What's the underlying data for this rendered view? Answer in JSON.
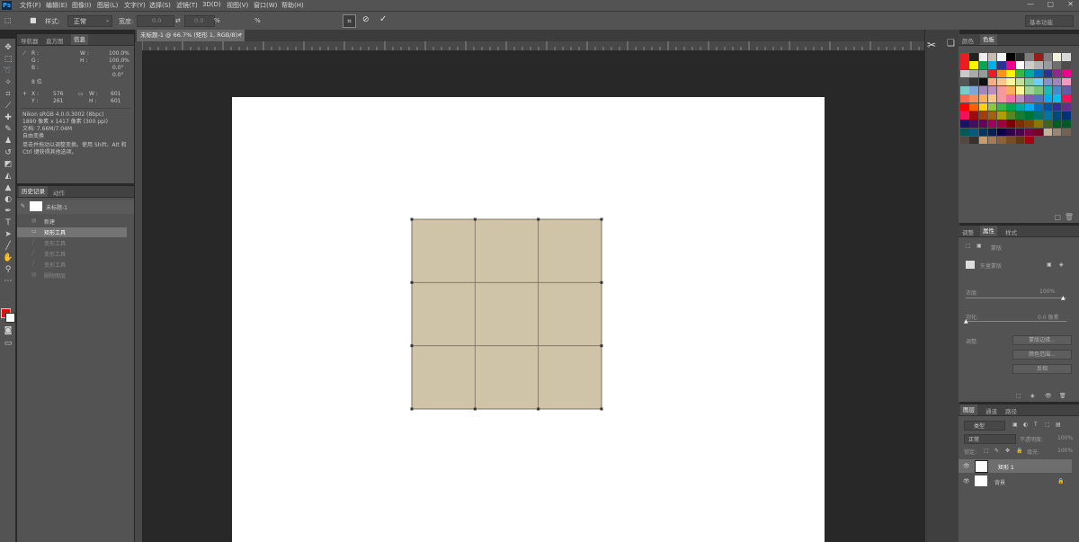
{
  "menu": {
    "logo": "Ps",
    "items": [
      "文件(F)",
      "编辑(E)",
      "图像(I)",
      "图层(L)",
      "文字(Y)",
      "选择(S)",
      "滤镜(T)",
      "3D(D)",
      "视图(V)",
      "窗口(W)",
      "帮助(H)"
    ]
  },
  "options": {
    "style_label": "样式:",
    "style_value": "正常",
    "width_label": "宽度:",
    "width_value": "0.0",
    "height_value": "0.0",
    "unit": "%",
    "search_placeholder": "基本功能"
  },
  "document": {
    "tab_title": "未标题-1 @ 66.7% (矩形 1, RGB/8) *"
  },
  "info_panel": {
    "tabs": [
      "导航器",
      "直方图",
      "信息"
    ],
    "rgb": [
      "R :",
      "G :",
      "B :"
    ],
    "bit": "8 位",
    "x_label": "X :",
    "x_value": "576",
    "y_label": "Y :",
    "y_value": "261",
    "w_label": "W :",
    "w_value": "601",
    "h_label": "H :",
    "h_value": "601",
    "pct_w": "100.0%",
    "pct_h": "100.0%",
    "angle1": "0.0°",
    "angle2": "0.0°",
    "doc_line1": "Nikon sRGB 4.0.0.3002 (8bpc)",
    "doc_line2": "1890 像素 x 1417 像素 (300 ppi)",
    "doc_line3": "文档: 7.66M/7.04M",
    "doc_line4": "自由变换",
    "hint": "单击并拖动以调整变换。使用 Shift、Alt 和 Ctrl 键获得其他选项。"
  },
  "history_panel": {
    "tabs": [
      "历史记录",
      "动作"
    ],
    "snapshot": "未标题-1",
    "items": [
      "新建",
      "矩形工具",
      "变形工具",
      "变形工具",
      "变形工具",
      "删除图层"
    ]
  },
  "swatches_panel": {
    "tabs": [
      "颜色",
      "色板"
    ],
    "colors": [
      "#ec1c24",
      "#222222",
      "#eeeeee",
      "#c8beb0",
      "#f4f4f4",
      "#000000",
      "#2b2b2b",
      "#7d7d7d",
      "#9b1b1b",
      "#7f7f7f",
      "#f2f2dc",
      "#d8d8d8",
      "#ed1c24",
      "#fff200",
      "#00a651",
      "#00aeef",
      "#2e3192",
      "#ec008c",
      "#ffffff",
      "#cdcdcd",
      "#b2b2b2",
      "#9a9a9a",
      "#6f6f6f",
      "#4d4d4d",
      "#c9c9c9",
      "#aaaaaa",
      "#9b9b9b",
      "#ed1c24",
      "#f7941d",
      "#fff200",
      "#39b54a",
      "#00a99d",
      "#0072bc",
      "#2e3192",
      "#92278f",
      "#ec008c",
      "#555555",
      "#333333",
      "#111111",
      "#f9ad81",
      "#fdc689",
      "#fff799",
      "#c4df9b",
      "#82ca9c",
      "#6dcff6",
      "#8393ca",
      "#a186be",
      "#f49ac2",
      "#7accc8",
      "#7ea7d8",
      "#a187be",
      "#bd8cbf",
      "#f6989d",
      "#fbaf5d",
      "#fff79a",
      "#a3d39c",
      "#7cc576",
      "#1cbbb4",
      "#448ccb",
      "#605ca8",
      "#f26c4f",
      "#f68e56",
      "#fbaf5d",
      "#fdc689",
      "#f6989d",
      "#f06eaa",
      "#bd8cbf",
      "#8560a8",
      "#5674b9",
      "#00aef0",
      "#00bff3",
      "#ed145b",
      "#ff0000",
      "#ff6000",
      "#ffd200",
      "#8dc63f",
      "#39b54a",
      "#00a651",
      "#00a99d",
      "#00aeef",
      "#0072bc",
      "#0054a6",
      "#2e3192",
      "#662d91",
      "#ed145b",
      "#9e0b0f",
      "#a0410d",
      "#a36209",
      "#aba000",
      "#598527",
      "#197b30",
      "#007236",
      "#00746b",
      "#0076a3",
      "#004a80",
      "#003471",
      "#1b1464",
      "#440e62",
      "#630460",
      "#9e005d",
      "#9e0039",
      "#790000",
      "#7b2e00",
      "#7d4900",
      "#827b00",
      "#406618",
      "#005e20",
      "#005826",
      "#005952",
      "#005b7f",
      "#003663",
      "#002157",
      "#0d004c",
      "#32004b",
      "#4b0049",
      "#7b0046",
      "#7a0026",
      "#c7b299",
      "#998675",
      "#736357",
      "#534741",
      "#37302d",
      "#c69c6d",
      "#a67c52",
      "#8c6239",
      "#754c24",
      "#603913",
      "#a4040f"
    ]
  },
  "properties_panel": {
    "tabs": [
      "调整",
      "属性",
      "样式"
    ],
    "label_mask": "蒙版",
    "item_vector": "矢量蒙版",
    "density_label": "浓度:",
    "density_value": "100%",
    "feather_label": "羽化:",
    "feather_value": "0.0 像素",
    "refine_label": "调整:",
    "btn_edge": "蒙版边缘...",
    "btn_color": "颜色范围...",
    "btn_invert": "反相"
  },
  "layers_panel": {
    "tabs": [
      "图层",
      "通道",
      "路径"
    ],
    "search_kind": "类型",
    "blend_mode": "正常",
    "opacity_label": "不透明度:",
    "opacity_value": "100%",
    "lock_label": "锁定:",
    "fill_label": "填充:",
    "fill_value": "100%",
    "layers": [
      {
        "name": "矩形 1"
      },
      {
        "name": "背景"
      }
    ]
  },
  "colors": {
    "foreground": "#e01010",
    "background": "#ffffff",
    "shape_fill": "#d0c4a8",
    "shape_stroke": "#7b705e"
  },
  "warp_grid": {
    "rows": 3,
    "cols": 3
  }
}
